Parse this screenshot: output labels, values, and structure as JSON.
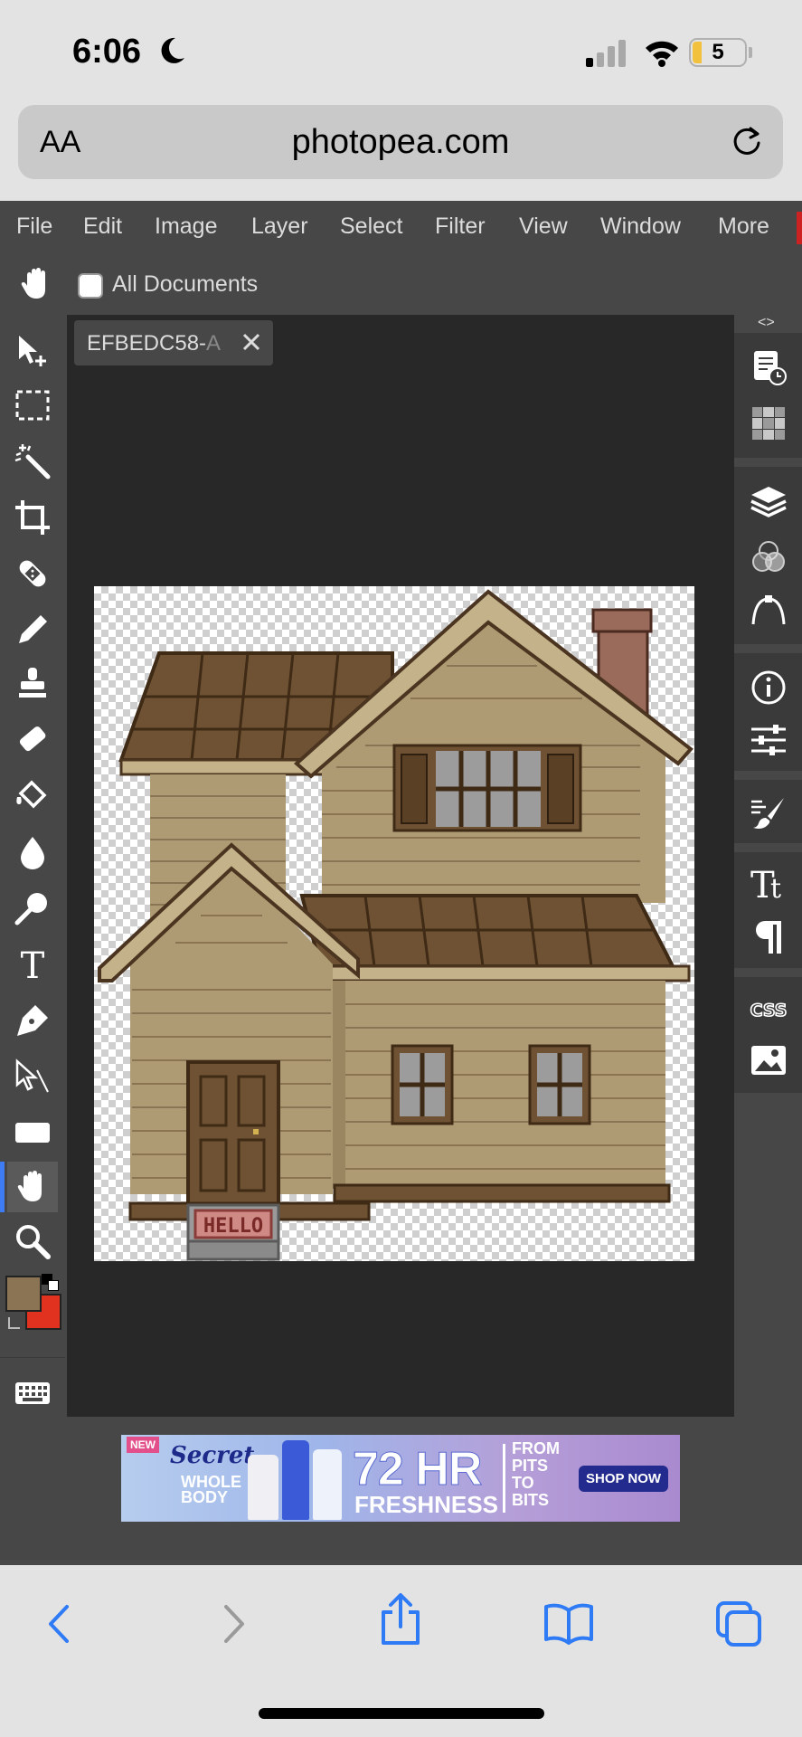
{
  "status": {
    "time": "6:06",
    "battery": "5"
  },
  "browser": {
    "text_size_label": "AA",
    "url": "photopea.com"
  },
  "menu": [
    "File",
    "Edit",
    "Image",
    "Layer",
    "Select",
    "Filter",
    "View",
    "Window",
    "More"
  ],
  "options": {
    "all_documents_label": "All Documents",
    "all_documents_checked": false
  },
  "document": {
    "tab_title": "EFBEDC58-",
    "tab_title_faded": "A"
  },
  "image_content": {
    "sign_text": "HELLO"
  },
  "colors": {
    "foreground": "#8a7453",
    "background": "#e0321f",
    "accent": "#3d7cf2"
  },
  "right_panel": {
    "css_label": "CSS"
  },
  "ad": {
    "new_label": "NEW",
    "brand": "Secret",
    "line1": "WHOLE",
    "line2": "BODY",
    "headline": "72 HR",
    "sub": "FRESHNESS",
    "pits": [
      "FROM",
      "PITS",
      "TO",
      "BITS"
    ],
    "cta": "SHOP NOW"
  }
}
